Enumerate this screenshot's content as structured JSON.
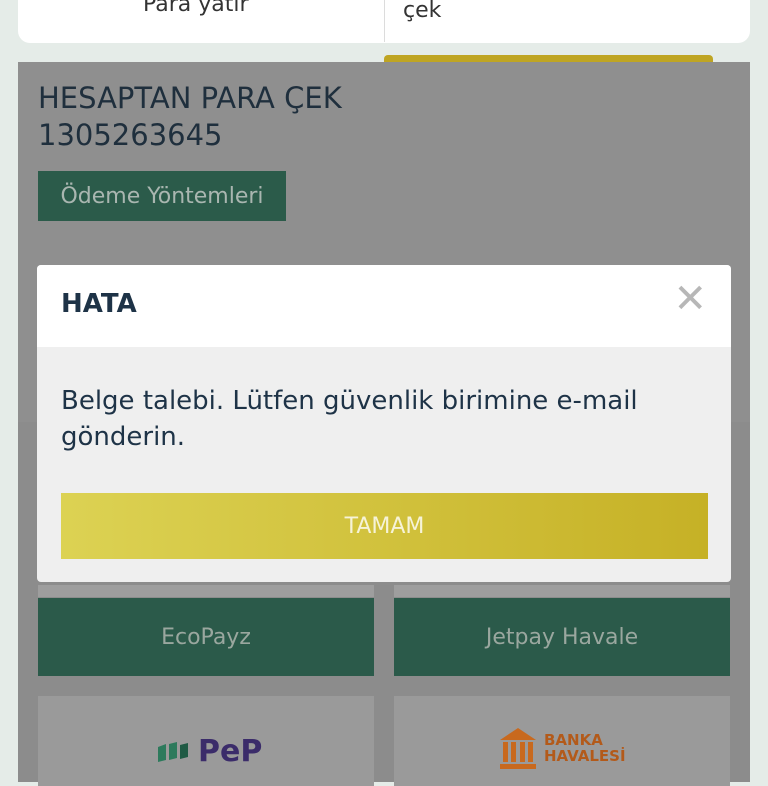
{
  "top_card": {
    "left_text": "Para yatır",
    "right_text": "çek"
  },
  "panel": {
    "title_line1": "HESAPTAN PARA ÇEK",
    "title_line2": "1305263645",
    "methods_button": "Ödeme Yöntemleri"
  },
  "tiles": [
    {
      "label": "EcoPayz"
    },
    {
      "label": "Jetpay Havale"
    }
  ],
  "logos": {
    "pep": "PeP",
    "bank_line1": "BANKA",
    "bank_line2": "HAVALESİ"
  },
  "modal": {
    "title": "HATA",
    "close_glyph": "✕",
    "message": "Belge talebi. Lütfen güvenlik birimine e-mail gönderin.",
    "ok_button": "TAMAM"
  },
  "colors": {
    "accent_green": "#2b5b4a",
    "accent_yellow": "#c6b126",
    "text_dark": "#1e3347"
  }
}
